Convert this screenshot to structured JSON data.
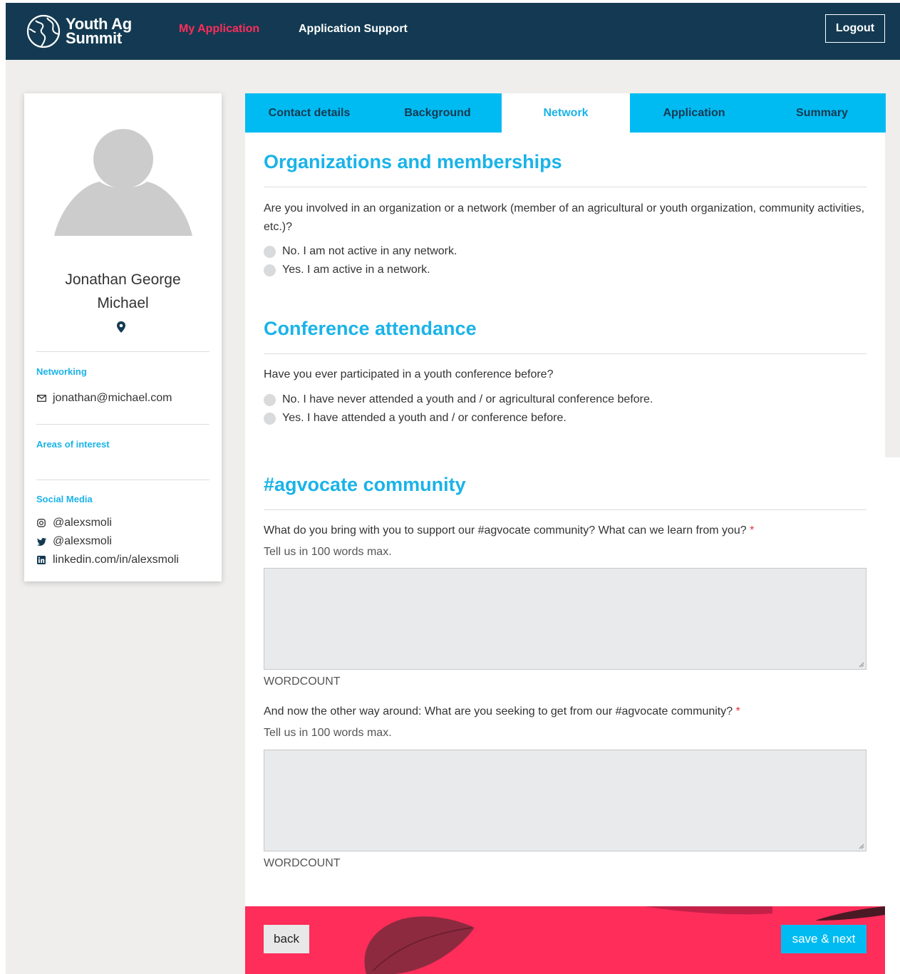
{
  "header": {
    "logo_line1": "Youth Ag",
    "logo_line2": "Summit",
    "nav_my_application": "My Application",
    "nav_support": "Application Support",
    "logout": "Logout"
  },
  "profile": {
    "name_line1": "Jonathan George",
    "name_line2": "Michael",
    "networking_label": "Networking",
    "email": "jonathan@michael.com",
    "areas_label": "Areas of interest",
    "social_label": "Social Media",
    "instagram": "@alexsmoli",
    "twitter": "@alexsmoli",
    "linkedin": "linkedin.com/in/alexsmoli"
  },
  "tabs": [
    "Contact details",
    "Background",
    "Network",
    "Application",
    "Summary"
  ],
  "active_tab": "Network",
  "org": {
    "title": "Organizations and memberships",
    "question": "Are you involved in an organization or a network (member of an agricultural or youth organization, community activities, etc.)?",
    "opt_no": "No. I am not active in any network.",
    "opt_yes": "Yes. I am active in a network."
  },
  "conf": {
    "title": "Conference attendance",
    "question": "Have you ever participated in a youth conference before?",
    "opt_no": "No. I have never attended a youth and / or agricultural conference before.",
    "opt_yes": "Yes. I have attended a youth and / or conference before."
  },
  "agvocate": {
    "title": "#agvocate community",
    "q1": "What do you bring with you to support our #agvocate community? What can we learn from you?",
    "q2": "And now the other way around: What are you seeking to get from our #agvocate community?",
    "required_mark": "*",
    "hint": "Tell us in 100 words max.",
    "wordcount": "WORDCOUNT"
  },
  "footer": {
    "back": "back",
    "next": "save & next"
  },
  "colors": {
    "navy": "#133a52",
    "accent_blue": "#00bbf2",
    "accent_pink": "#ff2d5a"
  }
}
